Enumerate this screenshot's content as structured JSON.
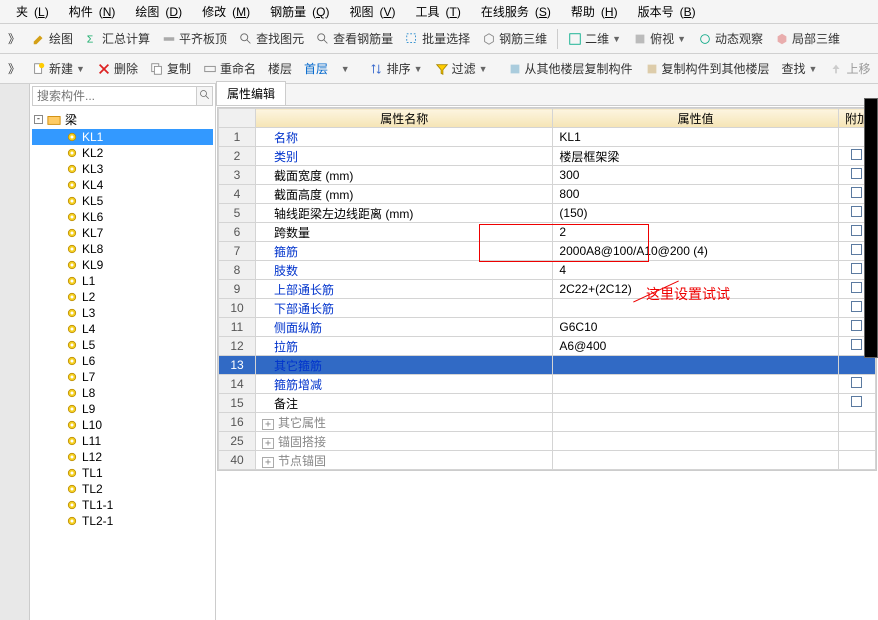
{
  "menu": {
    "items": [
      {
        "label": "夹",
        "key": "L"
      },
      {
        "label": "构件",
        "key": "N"
      },
      {
        "label": "绘图",
        "key": "D"
      },
      {
        "label": "修改",
        "key": "M"
      },
      {
        "label": "钢筋量",
        "key": "Q"
      },
      {
        "label": "视图",
        "key": "V"
      },
      {
        "label": "工具",
        "key": "T"
      },
      {
        "label": "在线服务",
        "key": "S"
      },
      {
        "label": "帮助",
        "key": "H"
      },
      {
        "label": "版本号",
        "key": "B"
      }
    ]
  },
  "toolbar1": {
    "draw": "绘图",
    "summary": "汇总计算",
    "align": "平齐板顶",
    "find_elem": "查找图元",
    "find_rebar": "查看钢筋量",
    "batch_select": "批量选择",
    "rebar3d": "钢筋三维",
    "twod": "二维",
    "top": "俯视",
    "dynamic": "动态观察",
    "local3d": "局部三维"
  },
  "toolbar2": {
    "new": "新建",
    "delete": "删除",
    "copy": "复制",
    "rename": "重命名",
    "floor": "楼层",
    "first_floor": "首层",
    "sort": "排序",
    "filter": "过滤",
    "copy_from": "从其他楼层复制构件",
    "copy_to": "复制构件到其他楼层",
    "find": "查找",
    "up": "上移"
  },
  "search": {
    "placeholder": "搜索构件..."
  },
  "tree": {
    "root": "梁",
    "items": [
      "KL1",
      "KL2",
      "KL3",
      "KL4",
      "KL5",
      "KL6",
      "KL7",
      "KL8",
      "KL9",
      "L1",
      "L2",
      "L3",
      "L4",
      "L5",
      "L6",
      "L7",
      "L8",
      "L9",
      "L10",
      "L11",
      "L12",
      "TL1",
      "TL2",
      "TL1-1",
      "TL2-1"
    ],
    "selected": "KL1"
  },
  "tab": {
    "label": "属性编辑"
  },
  "grid": {
    "headers": {
      "name": "属性名称",
      "value": "属性值",
      "extra": "附加"
    },
    "rows": [
      {
        "n": "1",
        "name": "名称",
        "val": "KL1",
        "blue": true
      },
      {
        "n": "2",
        "name": "类别",
        "val": "楼层框架梁",
        "blue": true,
        "chk": true
      },
      {
        "n": "3",
        "name": "截面宽度 (mm)",
        "val": "300",
        "chk": true
      },
      {
        "n": "4",
        "name": "截面高度 (mm)",
        "val": "800",
        "chk": true
      },
      {
        "n": "5",
        "name": "轴线距梁左边线距离 (mm)",
        "val": " (150)",
        "chk": true
      },
      {
        "n": "6",
        "name": "跨数量",
        "val": "2",
        "chk": true
      },
      {
        "n": "7",
        "name": "箍筋",
        "val": "2000A8@100/A10@200 (4)",
        "blue": true,
        "chk": true,
        "boxed": true
      },
      {
        "n": "8",
        "name": "肢数",
        "val": "4",
        "blue": true,
        "chk": true,
        "boxed": true
      },
      {
        "n": "9",
        "name": "上部通长筋",
        "val": "2C22+(2C12)",
        "blue": true,
        "chk": true
      },
      {
        "n": "10",
        "name": "下部通长筋",
        "val": "",
        "blue": true,
        "chk": true
      },
      {
        "n": "11",
        "name": "侧面纵筋",
        "val": "G6C10",
        "blue": true,
        "chk": true
      },
      {
        "n": "12",
        "name": "拉筋",
        "val": "A6@400",
        "blue": true,
        "chk": true
      },
      {
        "n": "13",
        "name": "其它箍筋",
        "val": "",
        "blue": true,
        "selected": true
      },
      {
        "n": "14",
        "name": "箍筋增减",
        "val": "",
        "blue": true,
        "chk": true
      },
      {
        "n": "15",
        "name": "备注",
        "val": "",
        "chk": true
      },
      {
        "n": "16",
        "name": "其它属性",
        "val": "",
        "expand": true,
        "gray": true
      },
      {
        "n": "25",
        "name": "锚固搭接",
        "val": "",
        "expand": true,
        "gray": true
      },
      {
        "n": "40",
        "name": "节点锚固",
        "val": "",
        "expand": true,
        "gray": true
      }
    ]
  },
  "annotation": {
    "text": "这里设置试试"
  }
}
